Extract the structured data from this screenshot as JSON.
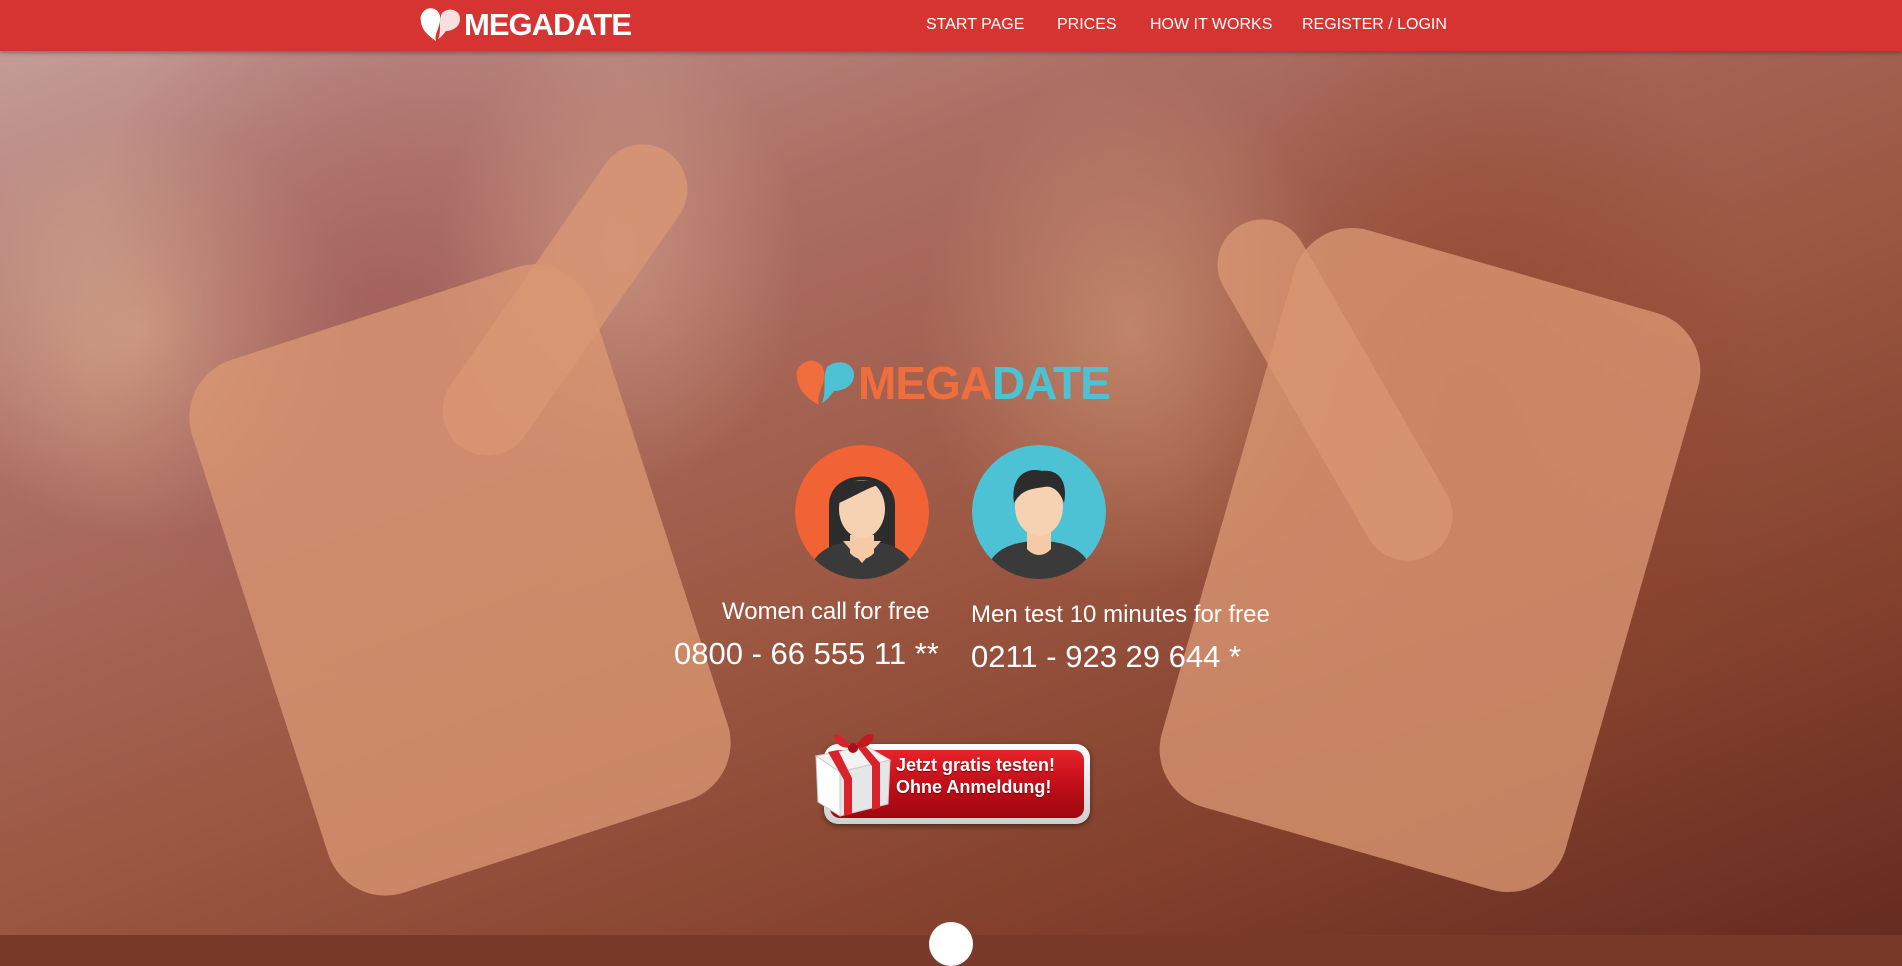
{
  "brand": {
    "name_part1": "MEGA",
    "name_part2": "DATE",
    "color_mega": "#f06d3d",
    "color_date": "#4cc2d4",
    "nav_color": "#d53432"
  },
  "nav": {
    "items": [
      {
        "label": "START PAGE"
      },
      {
        "label": "PRICES"
      },
      {
        "label": "HOW IT WORKS"
      },
      {
        "label": "REGISTER / LOGIN"
      }
    ]
  },
  "hero": {
    "women": {
      "label": "Women call for free",
      "number": "0800 - 66 555 11 **"
    },
    "men": {
      "label": "Men test 10 minutes for free",
      "number": "0211 - 923 29 644 *"
    },
    "cta": {
      "line1": "Jetzt gratis testen!",
      "line2": "Ohne Anmeldung!"
    }
  },
  "icons": [
    "heart-bubble-logo-icon",
    "woman-avatar-icon",
    "man-avatar-icon",
    "gift-box-icon",
    "scroll-down-icon"
  ]
}
